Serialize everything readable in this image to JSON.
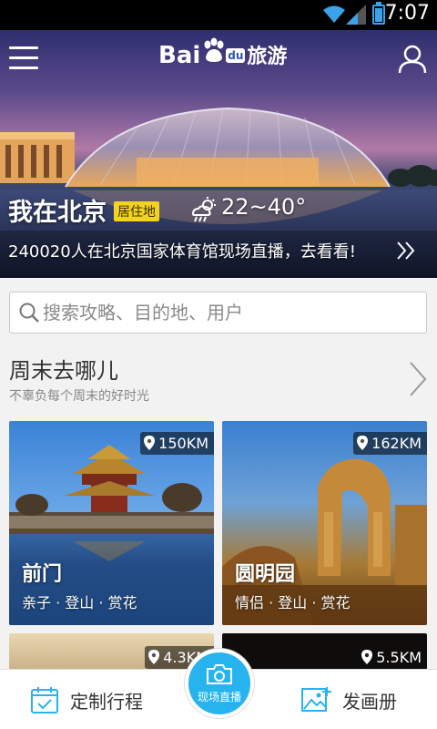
{
  "status_bar": {
    "time": "7:07"
  },
  "header": {
    "logo_text": "Bai",
    "logo_du": "du",
    "logo_cn": "旅游"
  },
  "hero": {
    "city_label": "我在北京",
    "resident_tag": "居住地",
    "temperature": "22~40°",
    "live_text": "240020人在北京国家体育馆现场直播，去看看!"
  },
  "search": {
    "placeholder": "搜索攻略、目的地、用户"
  },
  "weekend": {
    "title": "周末去哪儿",
    "subtitle": "不辜负每个周末的好时光",
    "cards": [
      {
        "name": "前门",
        "tags": "亲子 · 登山 · 赏花",
        "distance": "150KM"
      },
      {
        "name": "圆明园",
        "tags": "情侣 · 登山 · 赏花",
        "distance": "162KM"
      },
      {
        "name": "",
        "tags": "",
        "distance": "4.3KM"
      },
      {
        "name": "",
        "tags": "",
        "distance": "5.5KM"
      }
    ]
  },
  "bottom_bar": {
    "plan_label": "定制行程",
    "live_label": "现场直播",
    "album_label": "发画册"
  },
  "colors": {
    "accent": "#27b4ee",
    "tag_yellow": "#f3d31d",
    "battery": "#3ba3e8"
  }
}
